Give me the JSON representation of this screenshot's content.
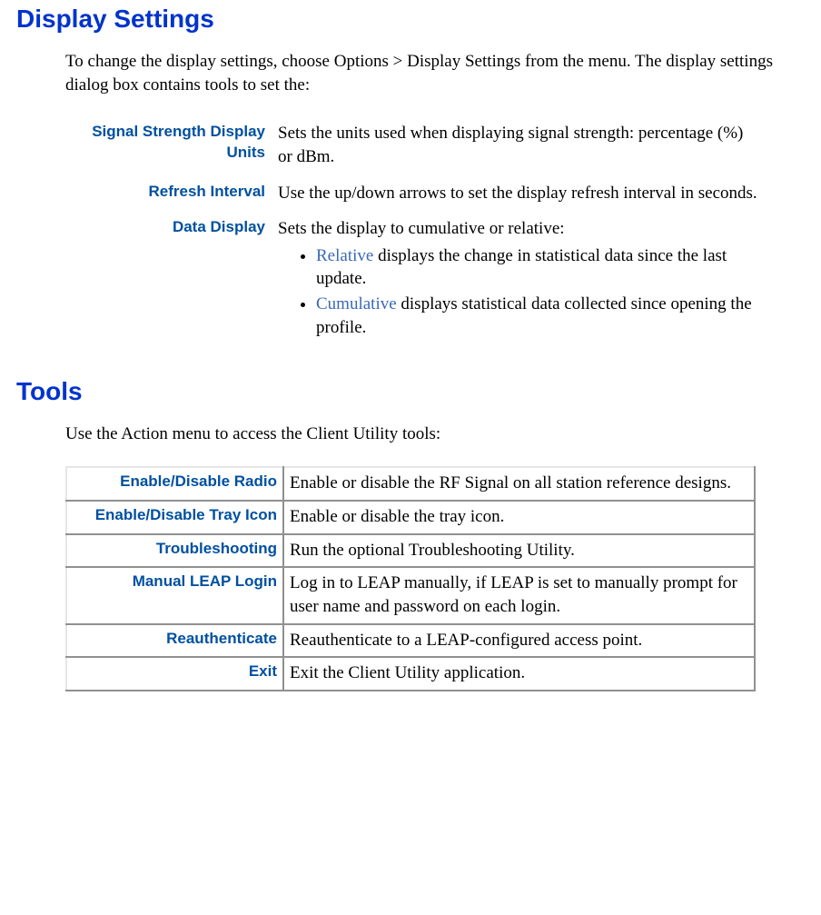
{
  "sections": {
    "display_settings": {
      "title": "Display Settings",
      "intro": "To change the display settings, choose Options > Display Settings from the menu. The display settings dialog box contains tools to set the:",
      "items": [
        {
          "label": "Signal Strength Display Units",
          "desc": "Sets the units used when displaying signal strength: percentage (%) or dBm."
        },
        {
          "label": "Refresh Interval",
          "desc": "Use the up/down arrows to set the display refresh interval in seconds."
        },
        {
          "label": "Data Display",
          "desc": "Sets the display to cumulative or relative:",
          "bullets": [
            {
              "term": "Relative",
              "rest": " displays the change in statistical data since the last update."
            },
            {
              "term": "Cumulative",
              "rest": " displays statistical data collected since opening the profile."
            }
          ]
        }
      ]
    },
    "tools": {
      "title": "Tools",
      "intro": "Use the Action menu to access the  Client Utility tools:",
      "rows": [
        {
          "label": "Enable/Disable Radio",
          "desc": "Enable or disable the RF Signal on all  station reference designs."
        },
        {
          "label": "Enable/Disable Tray Icon",
          "desc": "Enable or disable the tray icon."
        },
        {
          "label": "Troubleshooting",
          "desc": "Run the optional Troubleshooting Utility."
        },
        {
          "label": "Manual LEAP Login",
          "desc": "Log in to LEAP manually, if LEAP is set to manually prompt for user name and password on each login."
        },
        {
          "label": "Reauthenticate",
          "desc": "Reauthenticate to a LEAP-configured access point."
        },
        {
          "label": "Exit",
          "desc": "Exit the  Client Utility application."
        }
      ]
    }
  }
}
